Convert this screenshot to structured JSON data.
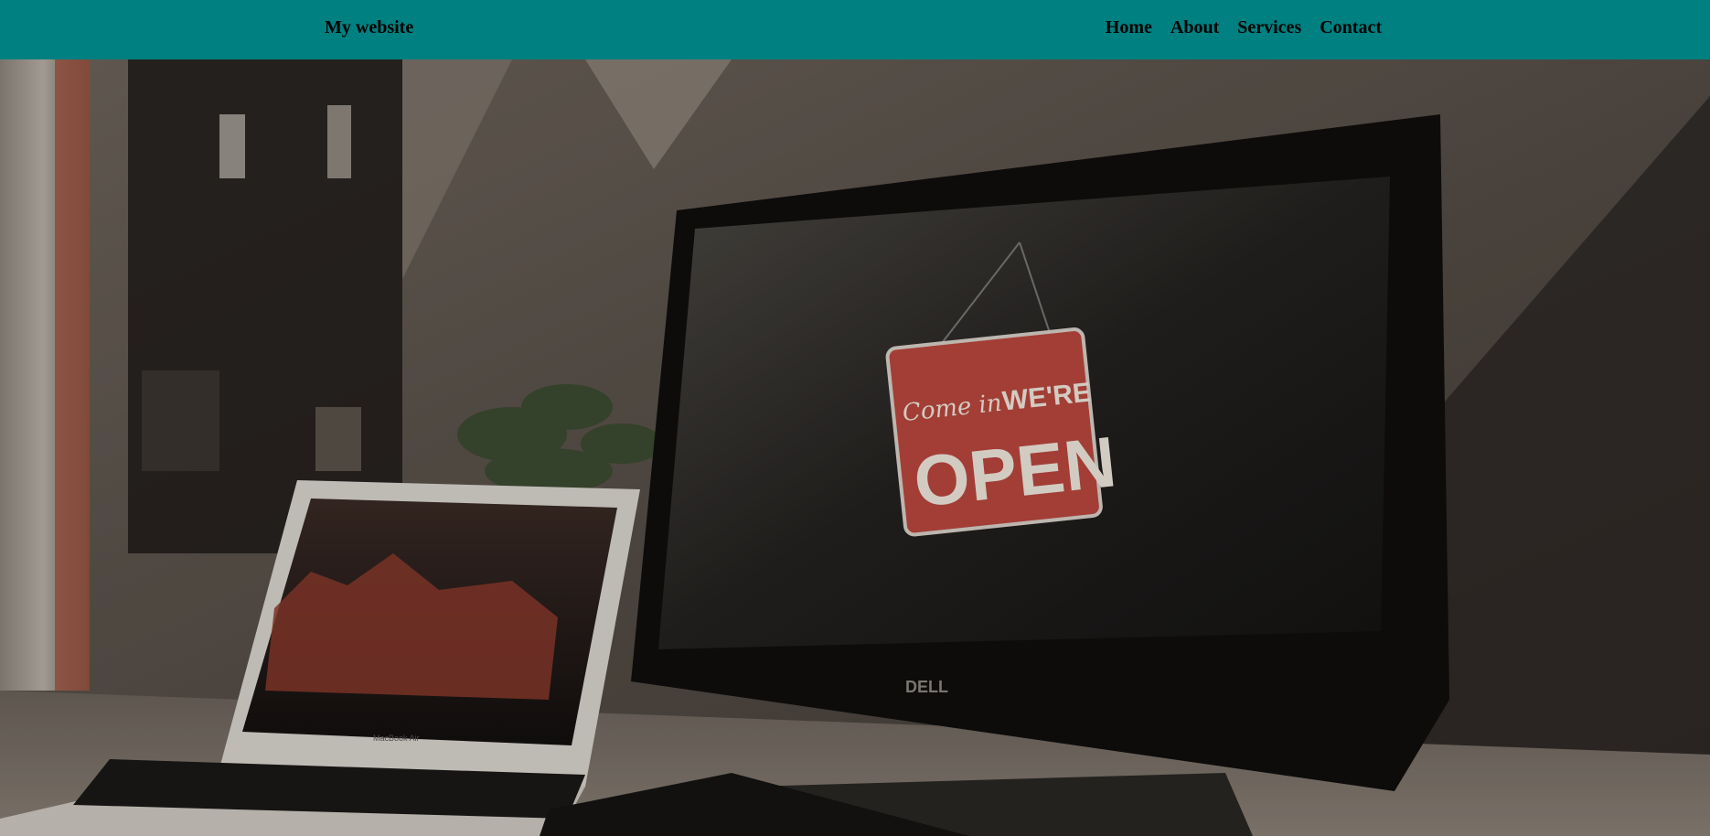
{
  "nav": {
    "brand": "My website",
    "links": [
      {
        "label": "Home"
      },
      {
        "label": "About"
      },
      {
        "label": "Services"
      },
      {
        "label": "Contact"
      }
    ]
  },
  "hero": {
    "image": "workspace-photo",
    "sign": {
      "script_text": "Come in",
      "top_text": "WE'RE",
      "main_text": "OPEN"
    },
    "monitor_brand": "DELL",
    "laptop_brand": "MacBook Air"
  },
  "colors": {
    "nav_background": "#008080",
    "nav_text": "#000000",
    "sign_red": "#b9473e"
  }
}
